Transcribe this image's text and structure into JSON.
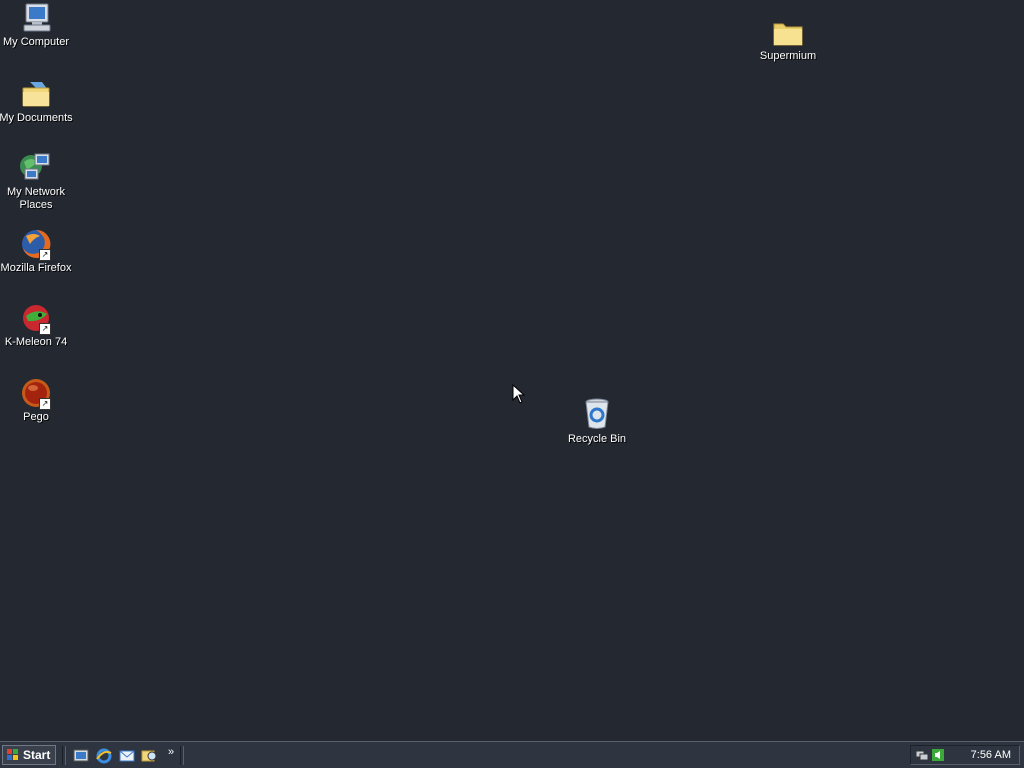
{
  "desktop": {
    "icons": {
      "my_computer": "My Computer",
      "my_documents": "My Documents",
      "my_network_places": "My Network Places",
      "mozilla_firefox": "Mozilla Firefox",
      "k_meleon": "K-Meleon 74",
      "pego": "Pego",
      "supermium": "Supermium",
      "recycle_bin": "Recycle Bin"
    }
  },
  "taskbar": {
    "start_label": "Start",
    "quick_launch": [
      "show-desktop-icon",
      "internet-explorer-icon",
      "outlook-express-icon",
      "search-icon"
    ],
    "overflow_label": "»",
    "clock": "7:56 AM"
  },
  "colors": {
    "desktop_background": "#232831",
    "taskbar_background": "#2f3540"
  }
}
